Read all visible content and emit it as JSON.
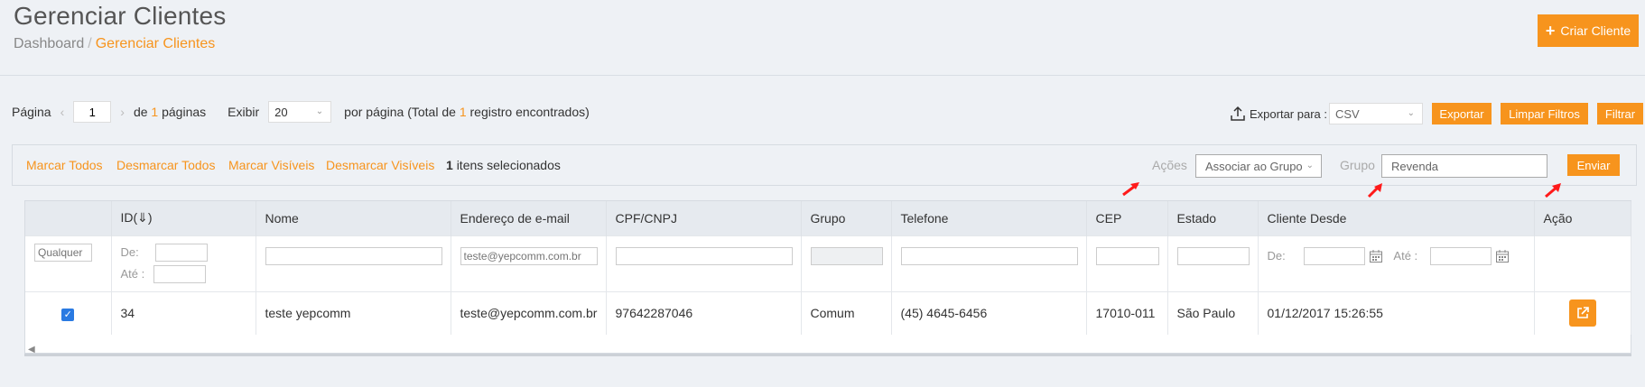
{
  "header": {
    "title": "Gerenciar Clientes",
    "breadcrumb": [
      "Dashboard",
      "Gerenciar Clientes"
    ],
    "create_button": "Criar Cliente"
  },
  "pager": {
    "page_label": "Página",
    "current_page": "1",
    "of_label": "de",
    "total_pages": "1",
    "pages_label": "páginas",
    "show_label": "Exibir",
    "per_page": "20",
    "per_page_label": "por página (Total de",
    "total_records": "1",
    "records_label": "registro encontrados)"
  },
  "export": {
    "label": "Exportar para :",
    "format": "CSV",
    "export_button": "Exportar",
    "clear_filters_button": "Limpar Filtros",
    "filter_button": "Filtrar"
  },
  "selection": {
    "mark_all": "Marcar Todos",
    "unmark_all": "Desmarcar Todos",
    "mark_visible": "Marcar Visíveis",
    "unmark_visible": "Desmarcar Visíveis",
    "selected_count": "1",
    "selected_label": "itens selecionados",
    "actions_label": "Ações",
    "action_value": "Associar ao Grupo",
    "group_label": "Grupo",
    "group_value": "Revenda",
    "submit_button": "Enviar"
  },
  "table": {
    "columns": [
      "ID(⇓)",
      "Nome",
      "Endereço de e-mail",
      "CPF/CNPJ",
      "Grupo",
      "Telefone",
      "CEP",
      "Estado",
      "Cliente Desde",
      "Ação"
    ],
    "filters": {
      "any_placeholder": "Qualquer",
      "from_label": "De:",
      "to_label": "Até :",
      "email_placeholder": "teste@yepcomm.com.br"
    },
    "rows": [
      {
        "checked": true,
        "id": "34",
        "name": "teste yepcomm",
        "email": "teste@yepcomm.com.br",
        "cpf": "97642287046",
        "group": "Comum",
        "phone": "(45) 4645-6456",
        "cep": "17010-011",
        "state": "São Paulo",
        "since": "01/12/2017 15:26:55"
      }
    ]
  },
  "colors": {
    "accent": "#f7941d",
    "background": "#eef1f5",
    "annotation": "#ff1a1a"
  }
}
